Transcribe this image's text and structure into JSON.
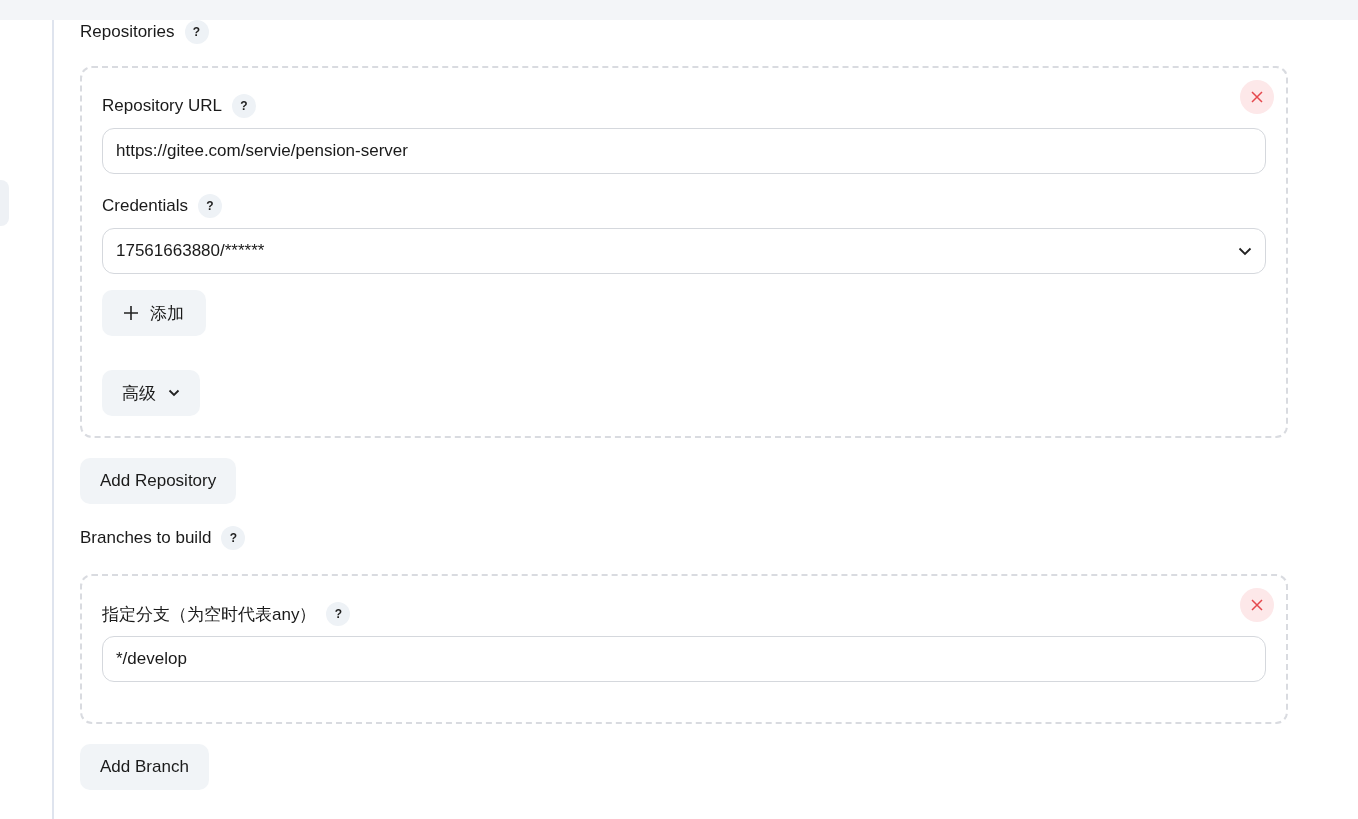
{
  "repositories": {
    "label": "Repositories",
    "help": "?",
    "items": [
      {
        "fields": [
          {
            "kind": "text",
            "label": "Repository URL",
            "help": "?",
            "value": "https://gitee.com/servie/pension-server"
          },
          {
            "kind": "select",
            "label": "Credentials",
            "help": "?",
            "value": "17561663880/******"
          }
        ],
        "add_button": "添加",
        "advanced_button": "高级"
      }
    ],
    "add_button": "Add Repository"
  },
  "branches": {
    "label": "Branches to build",
    "help": "?",
    "items": [
      {
        "fields": [
          {
            "kind": "text",
            "label": "指定分支（为空时代表any）",
            "help": "?",
            "value": "*/develop"
          }
        ]
      }
    ],
    "add_button": "Add Branch"
  }
}
